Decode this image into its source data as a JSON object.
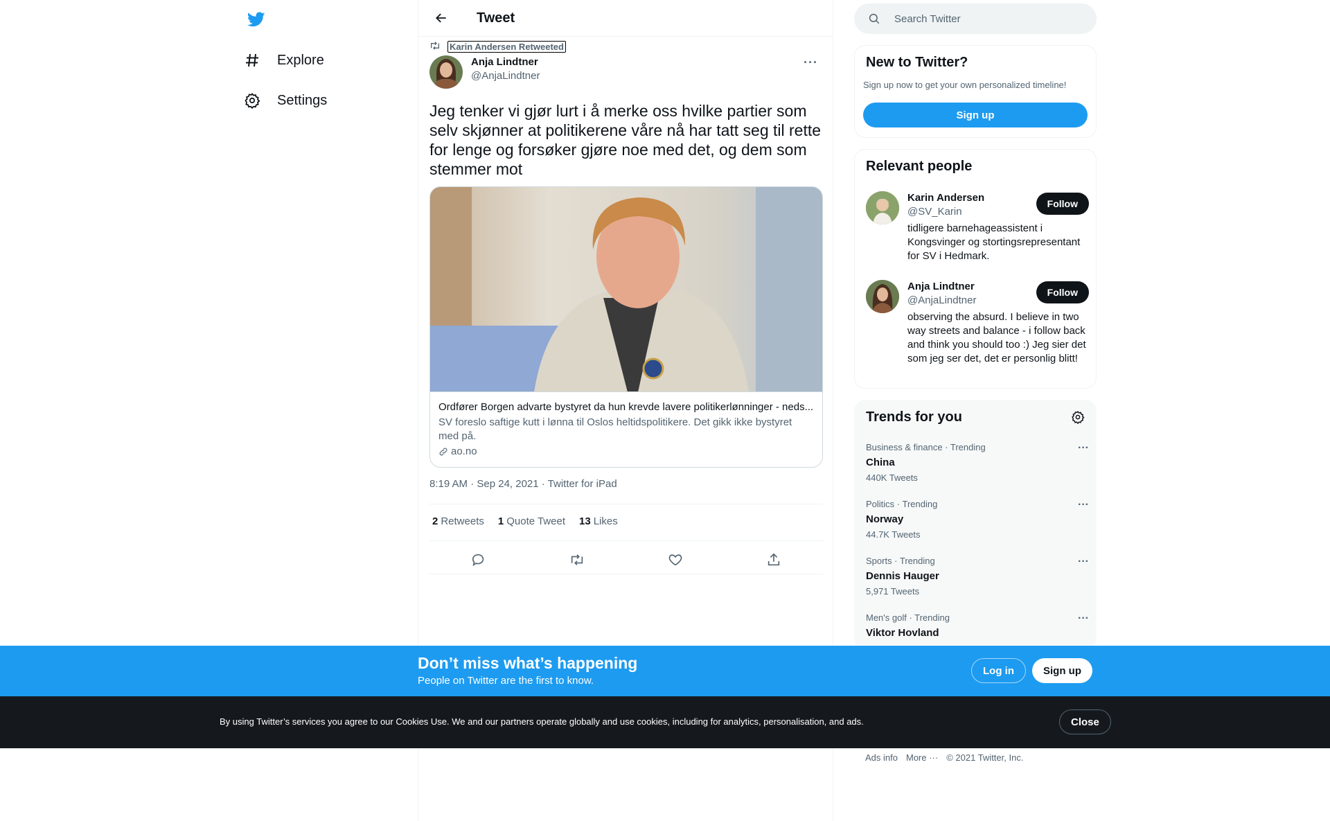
{
  "nav": {
    "explore_label": "Explore",
    "settings_label": "Settings"
  },
  "header": {
    "title": "Tweet"
  },
  "tweet": {
    "retweeted_by": "Karin Andersen Retweeted",
    "author_name": "Anja Lindtner",
    "author_handle": "@AnjaLindtner",
    "text": "Jeg tenker vi gjør lurt i å merke oss hvilke partier som selv skjønner at politikerene våre nå har tatt seg til rette for lenge og forsøker gjøre noe med det, og dem som stemmer mot",
    "card": {
      "title": "Ordfører Borgen advarte bystyret da hun krevde lavere politikerlønninger - neds...",
      "description": "SV foreslo saftige kutt i lønna til Oslos heltidspolitikere. Det gikk ikke bystyret med på.",
      "domain": "ao.no"
    },
    "meta": "8:19 AM · Sep 24, 2021 · Twitter for iPad",
    "stats": {
      "retweets_count": "2",
      "retweets_label": "Retweets",
      "quotes_count": "1",
      "quotes_label": "Quote Tweet",
      "likes_count": "13",
      "likes_label": "Likes"
    }
  },
  "search": {
    "placeholder": "Search Twitter"
  },
  "new_to_twitter": {
    "title": "New to Twitter?",
    "subtitle": "Sign up now to get your own personalized timeline!",
    "signup_label": "Sign up"
  },
  "relevant_people": {
    "title": "Relevant people",
    "people": [
      {
        "name": "Karin Andersen",
        "handle": "@SV_Karin",
        "bio": "tidligere barnehageassistent i Kongsvinger og stortingsrepresentant for SV i Hedmark.",
        "follow_label": "Follow"
      },
      {
        "name": "Anja Lindtner",
        "handle": "@AnjaLindtner",
        "bio": "observing the absurd. I believe in two way streets and balance - i follow back and think you should too :) Jeg sier det som jeg ser det, det er personlig blitt!",
        "follow_label": "Follow"
      }
    ]
  },
  "trends": {
    "title": "Trends for you",
    "items": [
      {
        "meta": "Business & finance · Trending",
        "name": "China",
        "count": "440K Tweets"
      },
      {
        "meta": "Politics · Trending",
        "name": "Norway",
        "count": "44.7K Tweets"
      },
      {
        "meta": "Sports · Trending",
        "name": "Dennis Hauger",
        "count": "5,971 Tweets"
      },
      {
        "meta": "Men's golf · Trending",
        "name": "Viktor Hovland",
        "count": ""
      }
    ]
  },
  "footer": {
    "ads_info": "Ads info",
    "more": "More ···",
    "copyright": "© 2021 Twitter, Inc."
  },
  "banner": {
    "title": "Don’t miss what’s happening",
    "subtitle": "People on Twitter are the first to know.",
    "login_label": "Log in",
    "signup_label": "Sign up"
  },
  "cookie": {
    "text": "By using Twitter’s services you agree to our Cookies Use. We and our partners operate globally and use cookies, including for analytics, personalisation, and ads.",
    "close_label": "Close"
  },
  "colors": {
    "brand": "#1d9bf0",
    "text": "#0f1419",
    "secondary": "#536471",
    "cookie_bg": "#15191e"
  }
}
